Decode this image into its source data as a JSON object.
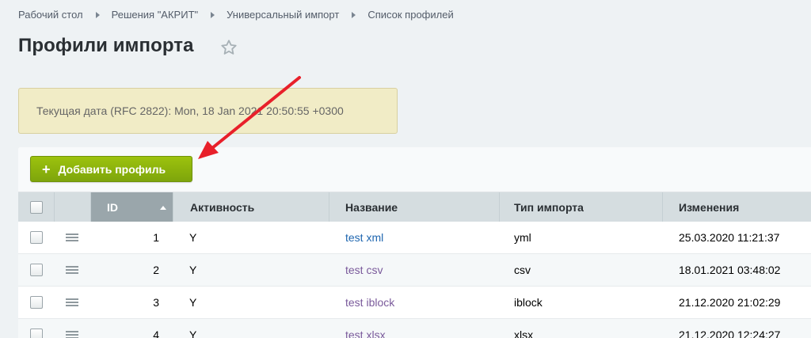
{
  "breadcrumb": [
    "Рабочий стол",
    "Решения \"АКРИТ\"",
    "Универсальный импорт",
    "Список профилей"
  ],
  "page_title": "Профили импорта",
  "notice": "Текущая дата (RFC 2822): Mon, 18 Jan 2021 20:50:55 +0300",
  "toolbar": {
    "add_label": "Добавить профиль"
  },
  "columns": {
    "id": "ID",
    "active": "Активность",
    "name": "Название",
    "type": "Тип импорта",
    "changed": "Изменения"
  },
  "rows": [
    {
      "id": "1",
      "active": "Y",
      "name": "test xml",
      "type": "yml",
      "changed": "25.03.2020 11:21:37"
    },
    {
      "id": "2",
      "active": "Y",
      "name": "test csv",
      "type": "csv",
      "changed": "18.01.2021 03:48:02"
    },
    {
      "id": "3",
      "active": "Y",
      "name": "test iblock",
      "type": "iblock",
      "changed": "21.12.2020 21:02:29"
    },
    {
      "id": "4",
      "active": "Y",
      "name": "test xlsx",
      "type": "xlsx",
      "changed": "21.12.2020 12:24:27"
    }
  ],
  "colors": {
    "accent_green": "#8ab30c",
    "link": "#2067b0",
    "arrow": "#e8202a"
  }
}
